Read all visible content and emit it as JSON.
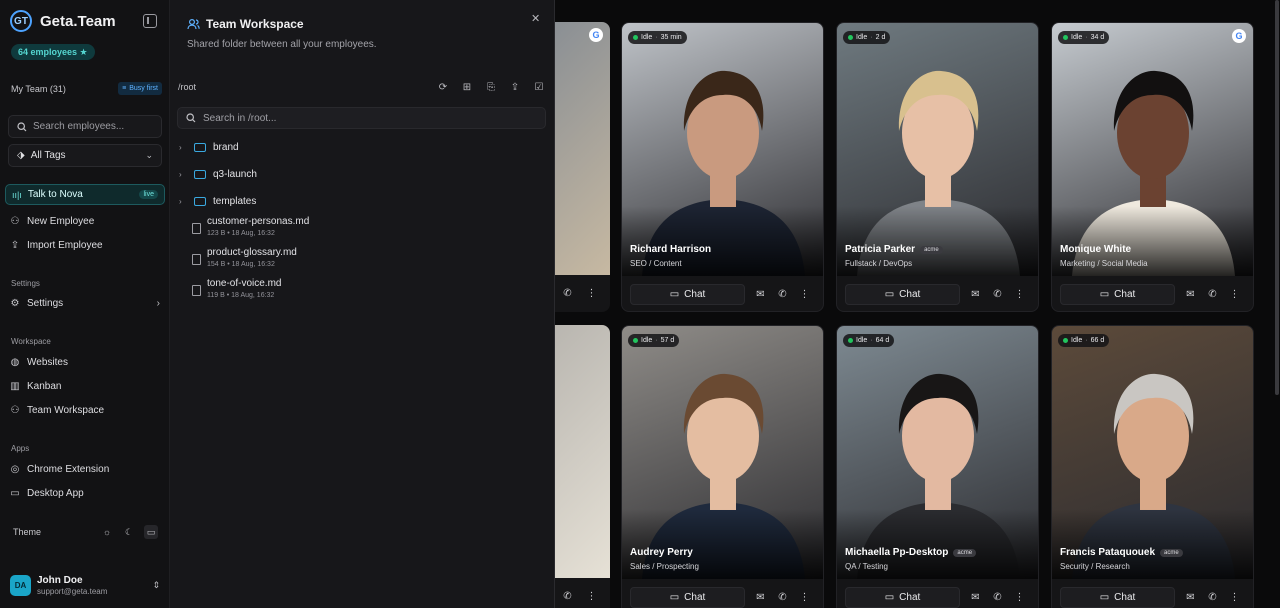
{
  "app": {
    "brand_name": "Geta.Team",
    "logo_text": "GT",
    "employees_badge": "64 employees ★",
    "team_label": "My Team (31)",
    "busy_first": "Busy first",
    "search_placeholder": "Search employees...",
    "all_tags": "All Tags",
    "talk_to": "Talk to Nova",
    "live": "live",
    "new_employee": "New Employee",
    "import_employee": "Import Employee",
    "settings_section": "Settings",
    "settings": "Settings",
    "workspace_section": "Workspace",
    "websites": "Websites",
    "kanban": "Kanban",
    "team_workspace": "Team Workspace",
    "apps_section": "Apps",
    "chrome_extension": "Chrome Extension",
    "desktop_app": "Desktop App",
    "theme": "Theme",
    "user": {
      "initials": "DA",
      "name": "John Doe",
      "email": "support@geta.team"
    }
  },
  "workspace": {
    "title": "Team Workspace",
    "subtitle": "Shared folder between all your employees.",
    "path": "/root",
    "search_placeholder": "Search in /root...",
    "folders": [
      "brand",
      "q3-launch",
      "templates"
    ],
    "files": [
      {
        "name": "customer-personas.md",
        "meta": "123 B • 18 Aug, 16:32"
      },
      {
        "name": "product-glossary.md",
        "meta": "154 B • 18 Aug, 16:32"
      },
      {
        "name": "tone-of-voice.md",
        "meta": "119 B • 18 Aug, 16:32"
      }
    ]
  },
  "cards": [
    {
      "status": "Idle",
      "time": "35 min",
      "name": "Richard Harrison",
      "role": "SEO / Content",
      "tag": "",
      "google": false,
      "bg": "#bfc3c8",
      "skin": "#c99a7f",
      "hair": "#3a2719",
      "suit": "#1d2433"
    },
    {
      "status": "Idle",
      "time": "2 d",
      "name": "Patricia Parker",
      "role": "Fullstack / DevOps",
      "tag": "acme",
      "google": false,
      "bg": "#6f7a80",
      "skin": "#e7c0a6",
      "hair": "#d8c08e",
      "suit": "#7f8388"
    },
    {
      "status": "Idle",
      "time": "34 d",
      "name": "Monique White",
      "role": "Marketing / Social Media",
      "tag": "",
      "google": true,
      "bg": "#c6cbd0",
      "skin": "#6b4231",
      "hair": "#121010",
      "suit": "#efe9de"
    },
    {
      "status": "Idle",
      "time": "57 d",
      "name": "Audrey Perry",
      "role": "Sales / Prospecting",
      "tag": "",
      "google": false,
      "bg": "#8f8c88",
      "skin": "#e4bda1",
      "hair": "#6a4a32",
      "suit": "#1f2a3d"
    },
    {
      "status": "Idle",
      "time": "64 d",
      "name": "Michaella Pp-Desktop",
      "role": "QA / Testing",
      "tag": "acme",
      "google": false,
      "bg": "#7e8a92",
      "skin": "#e3b9a1",
      "hair": "#181616",
      "suit": "#2b2c30"
    },
    {
      "status": "Idle",
      "time": "66 d",
      "name": "Francis Pataquouek",
      "role": "Security / Research",
      "tag": "acme",
      "google": false,
      "bg": "#5c4a3a",
      "skin": "#d9a989",
      "hair": "#c9c6c2",
      "suit": "#2e3440"
    }
  ],
  "card_actions": {
    "chat": "Chat"
  },
  "icons": {
    "mail": "mail-icon",
    "phone": "phone-icon",
    "more": "more-icon",
    "google": "google-icon"
  }
}
